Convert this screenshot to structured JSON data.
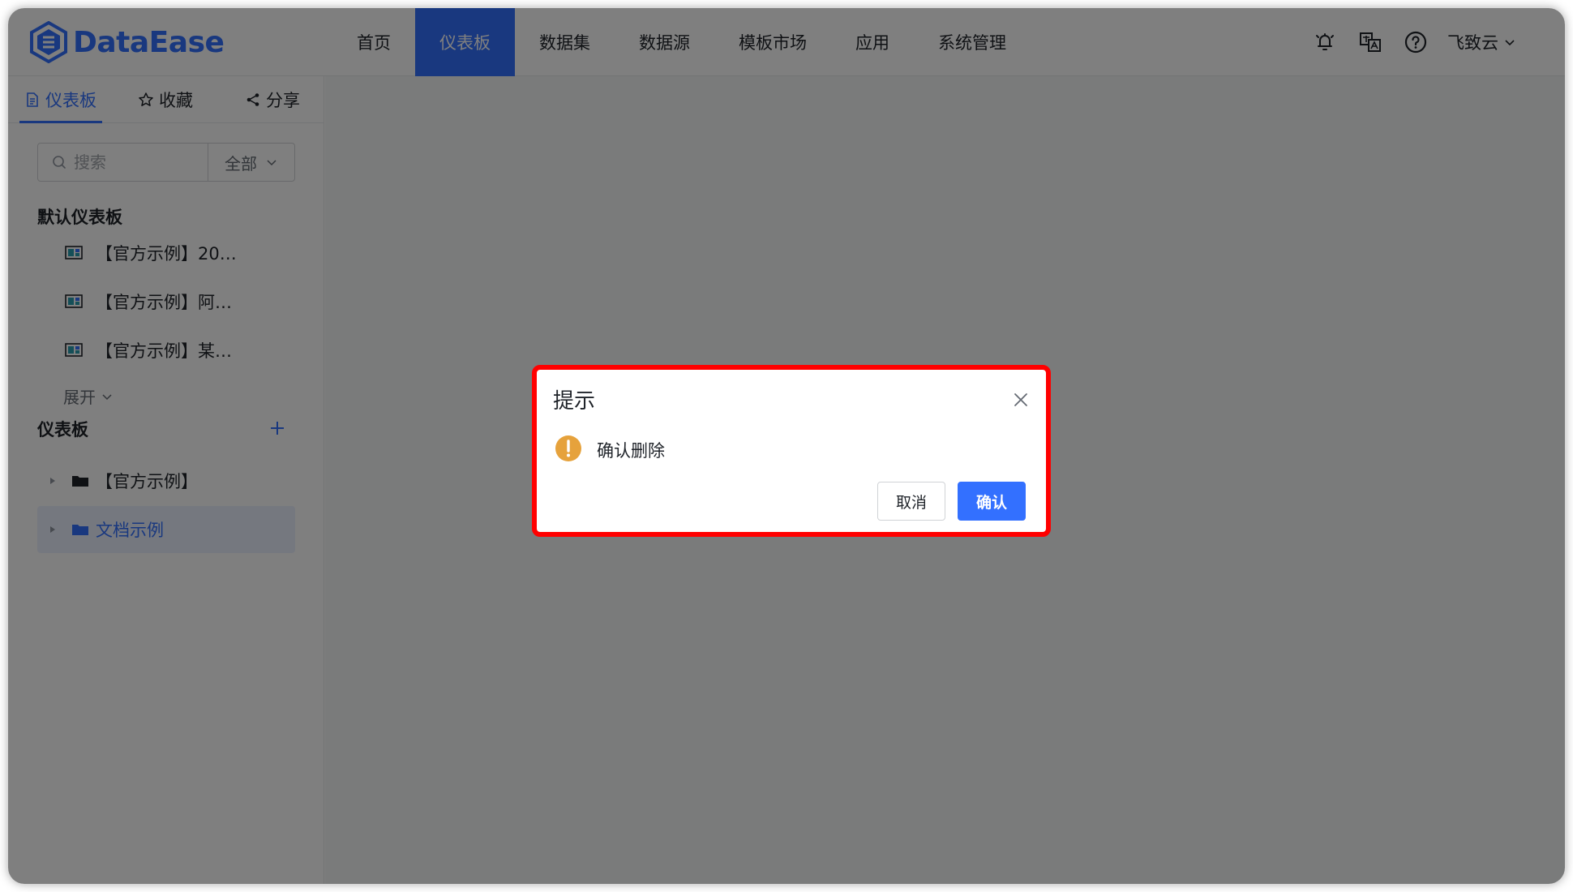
{
  "app": {
    "logo_text": "DataEase",
    "accent_color": "#3370ff"
  },
  "nav": {
    "items": [
      {
        "label": "首页"
      },
      {
        "label": "仪表板",
        "active": true
      },
      {
        "label": "数据集"
      },
      {
        "label": "数据源"
      },
      {
        "label": "模板市场"
      },
      {
        "label": "应用"
      },
      {
        "label": "系统管理"
      }
    ]
  },
  "header": {
    "icons": [
      "bell-icon",
      "translate-icon",
      "help-icon"
    ],
    "user_name": "飞致云"
  },
  "sidebar": {
    "tabs": [
      {
        "label": "仪表板",
        "icon": "document-icon",
        "active": true
      },
      {
        "label": "收藏",
        "icon": "star-icon"
      },
      {
        "label": "分享",
        "icon": "share-icon"
      }
    ],
    "search": {
      "placeholder": "搜索",
      "filter_value": "全部"
    },
    "default_section_title": "默认仪表板",
    "default_items": [
      {
        "label": "【官方示例】20…"
      },
      {
        "label": "【官方示例】阿…"
      },
      {
        "label": "【官方示例】某…"
      }
    ],
    "expand_label": "展开",
    "dashboard_section_title": "仪表板",
    "tree": [
      {
        "label": "【官方示例】",
        "selected": false
      },
      {
        "label": "文档示例",
        "selected": true
      }
    ]
  },
  "dialog": {
    "title": "提示",
    "message": "确认删除",
    "cancel_label": "取消",
    "confirm_label": "确认",
    "warning_color": "#e6a23c"
  }
}
